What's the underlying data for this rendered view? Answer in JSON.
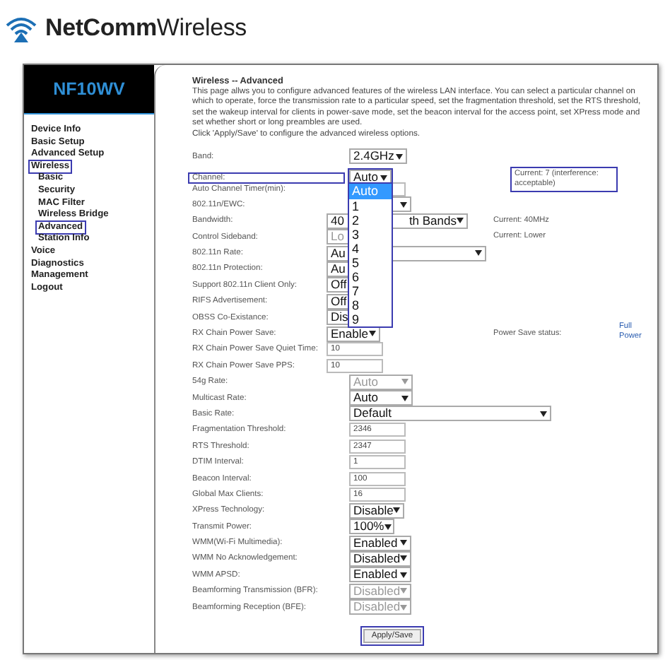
{
  "brand": {
    "name": "**NetComm**Wireless"
  },
  "sidebar": {
    "model": "NF10WV",
    "items": [
      {
        "label": "Device Info",
        "highlighted": false
      },
      {
        "label": "Basic Setup",
        "highlighted": false
      },
      {
        "label": "Advanced Setup",
        "highlighted": false
      },
      {
        "label": "Wireless",
        "highlighted": true,
        "children": [
          {
            "label": "Basic",
            "highlighted": false
          },
          {
            "label": "Security",
            "highlighted": false
          },
          {
            "label": "MAC Filter",
            "highlighted": false
          },
          {
            "label": "Wireless Bridge",
            "highlighted": false
          },
          {
            "label": "Advanced",
            "highlighted": true
          },
          {
            "label": "Station Info",
            "highlighted": false
          }
        ]
      },
      {
        "label": "Voice",
        "highlighted": false
      },
      {
        "label": "Diagnostics",
        "highlighted": false
      },
      {
        "label": "Management",
        "highlighted": false
      },
      {
        "label": "Logout",
        "highlighted": false
      }
    ]
  },
  "page": {
    "title": "Wireless -- Advanced",
    "description": "This page allws you to configure advanced features of the wireless LAN interface. You can select a particular channel on which to operate, force the transmission rate to a particular speed, set the fragmentation threshold, set the RTS threshold, set the wakeup interval for clients in power-save mode, set the beacon interval for the access point, set XPress mode and set whether short or long preambles are used.",
    "instruction": "Click 'Apply/Save' to configure the advanced wireless options."
  },
  "settings": [
    {
      "label": "Band:",
      "kind": "select",
      "value": "2.4GHz",
      "disabled": false,
      "highlighted": false
    },
    {
      "label": "Channel:",
      "kind": "select",
      "value": "Auto",
      "disabled": false,
      "highlighted": true,
      "note": "Current: 7 (interference: acceptable)",
      "note_highlighted": true,
      "expanded": true,
      "options": [
        {
          "label": "Auto",
          "selected": true
        },
        {
          "label": "1",
          "selected": false
        },
        {
          "label": "2",
          "selected": false
        },
        {
          "label": "3",
          "selected": false
        },
        {
          "label": "4",
          "selected": false
        },
        {
          "label": "5",
          "selected": false
        },
        {
          "label": "6",
          "selected": false
        },
        {
          "label": "7",
          "selected": false
        },
        {
          "label": "8",
          "selected": false
        },
        {
          "label": "9",
          "selected": false
        }
      ]
    },
    {
      "label": "Auto Channel Timer(min):",
      "kind": "input",
      "highlighted": false
    },
    {
      "label": "802.11n/EWC:",
      "kind": "select",
      "disabled": false,
      "highlighted": false
    },
    {
      "label": "Bandwidth:",
      "kind": "select",
      "value": "40",
      "tail": "th Bands",
      "disabled": false,
      "highlighted": false,
      "note": "Current: 40MHz"
    },
    {
      "label": "Control Sideband:",
      "kind": "select",
      "value": "Lo",
      "disabled": true,
      "highlighted": false,
      "note": "Current: Lower"
    },
    {
      "label": "802.11n Rate:",
      "kind": "select",
      "value": "Au",
      "disabled": false,
      "highlighted": false
    },
    {
      "label": "802.11n Protection:",
      "kind": "select",
      "value": "Au",
      "disabled": false,
      "highlighted": false
    },
    {
      "label": "Support 802.11n Client Only:",
      "kind": "select",
      "value": "Off",
      "disabled": false,
      "highlighted": false
    },
    {
      "label": "RIFS Advertisement:",
      "kind": "select",
      "value": "Off",
      "disabled": false,
      "highlighted": false
    },
    {
      "label": "OBSS Co-Existance:",
      "kind": "select",
      "value": "Dis",
      "disabled": false,
      "highlighted": false
    },
    {
      "label": "RX Chain Power Save:",
      "kind": "select",
      "value": "Enable",
      "disabled": false,
      "highlighted": false,
      "note": "Power Save status:",
      "status": "Full Power"
    },
    {
      "label": "RX Chain Power Save Quiet Time:",
      "kind": "input",
      "value": "10",
      "highlighted": false
    },
    {
      "label": "RX Chain Power Save PPS:",
      "kind": "input",
      "value": "10",
      "highlighted": false
    },
    {
      "label": "54g Rate:",
      "kind": "select",
      "value": "Auto",
      "disabled": true,
      "highlighted": false
    },
    {
      "label": "Multicast Rate:",
      "kind": "select",
      "value": "Auto",
      "disabled": false,
      "highlighted": false
    },
    {
      "label": "Basic Rate:",
      "kind": "select",
      "value": "Default",
      "disabled": false,
      "highlighted": false
    },
    {
      "label": "Fragmentation Threshold:",
      "kind": "input",
      "value": "2346",
      "highlighted": false
    },
    {
      "label": "RTS Threshold:",
      "kind": "input",
      "value": "2347",
      "highlighted": false
    },
    {
      "label": "DTIM Interval:",
      "kind": "input",
      "value": "1",
      "highlighted": false
    },
    {
      "label": "Beacon Interval:",
      "kind": "input",
      "value": "100",
      "highlighted": false
    },
    {
      "label": "Global Max Clients:",
      "kind": "input",
      "value": "16",
      "highlighted": false
    },
    {
      "label": "XPress Technology:",
      "kind": "select",
      "value": "Disable",
      "disabled": false,
      "highlighted": false
    },
    {
      "label": "Transmit Power:",
      "kind": "select",
      "value": "100%",
      "disabled": false,
      "highlighted": false
    },
    {
      "label": "WMM(Wi-Fi Multimedia):",
      "kind": "select",
      "value": "Enabled",
      "disabled": false,
      "highlighted": false
    },
    {
      "label": "WMM No Acknowledgement:",
      "kind": "select",
      "value": "Disabled",
      "disabled": false,
      "highlighted": false
    },
    {
      "label": "WMM APSD:",
      "kind": "select",
      "value": "Enabled",
      "disabled": false,
      "highlighted": false
    },
    {
      "label": "Beamforming Transmission (BFR):",
      "kind": "select",
      "value": "Disabled",
      "disabled": true,
      "highlighted": false
    },
    {
      "label": "Beamforming Reception (BFE):",
      "kind": "select",
      "value": "Disabled",
      "disabled": true,
      "highlighted": false
    }
  ],
  "apply_button": {
    "label": "Apply/Save",
    "highlighted": true
  }
}
